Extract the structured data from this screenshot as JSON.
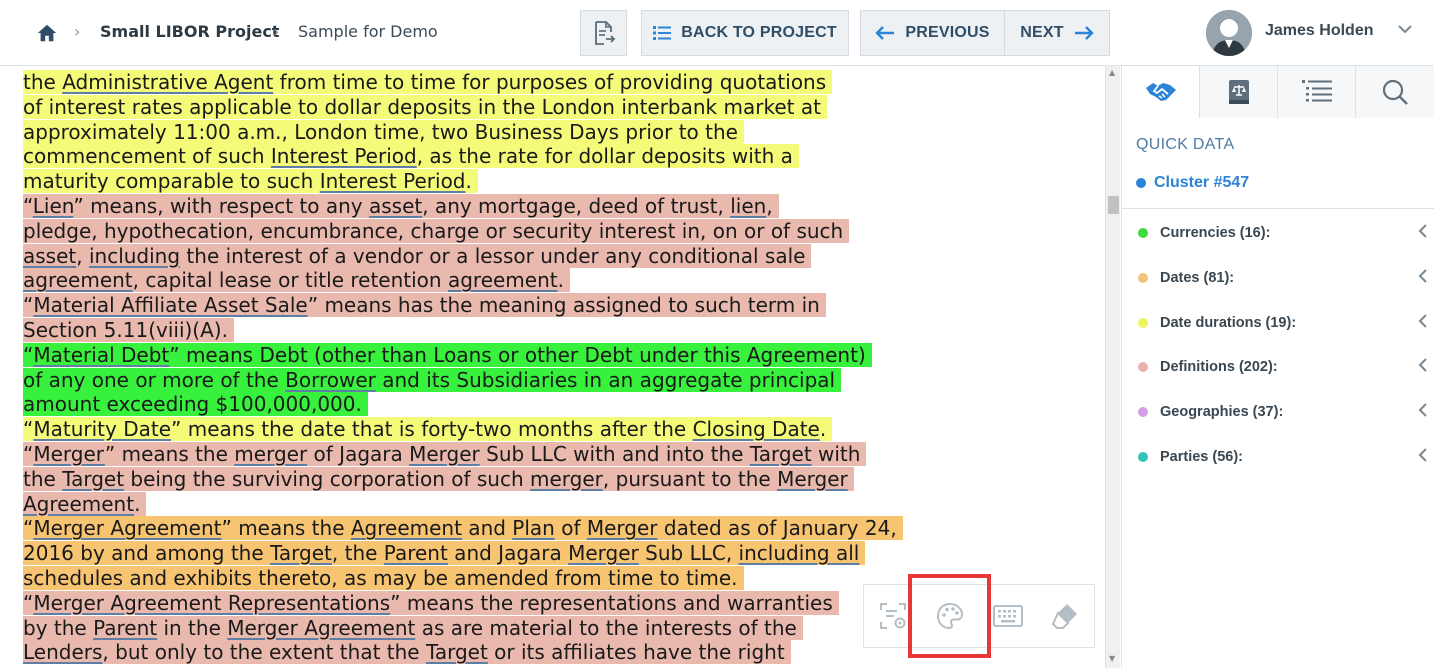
{
  "breadcrumb": {
    "project": "Small LIBOR Project",
    "document": "Sample for Demo"
  },
  "toolbar": {
    "back_label": "BACK TO PROJECT",
    "previous_label": "PREVIOUS",
    "next_label": "NEXT"
  },
  "user": {
    "name": "James Holden"
  },
  "document": {
    "lines": [
      {
        "hl": "y",
        "parts": [
          [
            "the "
          ],
          [
            "Administrative Agent",
            "u"
          ],
          [
            " from time to time for purposes of providing quotations"
          ]
        ]
      },
      {
        "hl": "y",
        "parts": [
          [
            "of interest rates applicable to dollar deposits in the London interbank market at"
          ]
        ]
      },
      {
        "hl": "y",
        "parts": [
          [
            "approximately 11:00 a.m., London time, two Business Days prior to the"
          ]
        ]
      },
      {
        "hl": "y",
        "parts": [
          [
            "commencement of such "
          ],
          [
            "Interest Period",
            "u"
          ],
          [
            ", as the rate for dollar deposits with a"
          ]
        ]
      },
      {
        "hl": "y",
        "parts": [
          [
            "maturity comparable to such "
          ],
          [
            "Interest Period",
            "u"
          ],
          [
            "."
          ]
        ]
      },
      {
        "hl": "p",
        "parts": [
          [
            "“"
          ],
          [
            "Lien",
            "u"
          ],
          [
            "” means, with respect to any "
          ],
          [
            "asset",
            "u"
          ],
          [
            ", any mortgage, deed of trust, "
          ],
          [
            "lien",
            "u"
          ],
          [
            ","
          ]
        ]
      },
      {
        "hl": "p",
        "parts": [
          [
            "pledge, hypothecation, encumbrance, charge or security interest in, on or of such"
          ]
        ]
      },
      {
        "hl": "p",
        "parts": [
          [
            "asset",
            "u"
          ],
          [
            ", "
          ],
          [
            "including",
            "u"
          ],
          [
            " the interest of a vendor or a lessor under any conditional sale"
          ]
        ]
      },
      {
        "hl": "p",
        "parts": [
          [
            "agreement",
            "u"
          ],
          [
            ", capital lease or title retention "
          ],
          [
            "agreement",
            "u"
          ],
          [
            "."
          ]
        ]
      },
      {
        "hl": "p",
        "parts": [
          [
            "“"
          ],
          [
            "Material Affiliate Asset Sale",
            "u"
          ],
          [
            "” means has the meaning assigned to such term in"
          ]
        ]
      },
      {
        "hl": "p",
        "parts": [
          [
            "Section 5.11(viii)(A)."
          ]
        ]
      },
      {
        "hl": "g",
        "parts": [
          [
            "“"
          ],
          [
            "Material Debt",
            "u"
          ],
          [
            "” means Debt (other than Loans or other Debt under this Agreement)"
          ]
        ]
      },
      {
        "hl": "g",
        "parts": [
          [
            "of any one or more of the "
          ],
          [
            "Borrower",
            "u"
          ],
          [
            " and its Subsidiaries in an aggregate principal"
          ]
        ]
      },
      {
        "hl": "g",
        "parts": [
          [
            "amount exceeding $100,000,000."
          ]
        ]
      },
      {
        "hl": "y",
        "parts": [
          [
            "“"
          ],
          [
            "Maturity Date",
            "u"
          ],
          [
            "” means the date that is forty-two months after the "
          ],
          [
            "Closing Date",
            "u"
          ],
          [
            "."
          ]
        ]
      },
      {
        "hl": "p",
        "parts": [
          [
            "“"
          ],
          [
            "Merger",
            "u"
          ],
          [
            "” means the "
          ],
          [
            "merger",
            "u"
          ],
          [
            " of Jagara "
          ],
          [
            "Merger",
            "u"
          ],
          [
            " Sub LLC with and into the "
          ],
          [
            "Target",
            "u"
          ],
          [
            " with"
          ]
        ]
      },
      {
        "hl": "p",
        "parts": [
          [
            "the "
          ],
          [
            "Target",
            "u"
          ],
          [
            " being the surviving corporation of such "
          ],
          [
            "merger",
            "u"
          ],
          [
            ", pursuant to the "
          ],
          [
            "Merger",
            "u"
          ]
        ]
      },
      {
        "hl": "p",
        "parts": [
          [
            "Agreement",
            "u"
          ],
          [
            "."
          ]
        ]
      },
      {
        "hl": "o",
        "parts": [
          [
            "“"
          ],
          [
            "Merger Agreement",
            "u"
          ],
          [
            "” means the "
          ],
          [
            "Agreement",
            "u"
          ],
          [
            " and "
          ],
          [
            "Plan",
            "u"
          ],
          [
            " of "
          ],
          [
            "Merger",
            "u"
          ],
          [
            " dated as of January 24,"
          ]
        ]
      },
      {
        "hl": "o",
        "parts": [
          [
            "2016 by and among the "
          ],
          [
            "Target",
            "u"
          ],
          [
            ", the "
          ],
          [
            "Parent",
            "u"
          ],
          [
            " and Jagara "
          ],
          [
            "Merger",
            "u"
          ],
          [
            " Sub LLC, "
          ],
          [
            "including all",
            "u"
          ]
        ]
      },
      {
        "hl": "o",
        "parts": [
          [
            "schedules and exhibits thereto, as may be amended from time to time."
          ]
        ]
      },
      {
        "hl": "p",
        "parts": [
          [
            "“"
          ],
          [
            "Merger Agreement Representations",
            "u"
          ],
          [
            "” means the representations and warranties"
          ]
        ]
      },
      {
        "hl": "p",
        "parts": [
          [
            "by the "
          ],
          [
            "Parent",
            "u"
          ],
          [
            " in the "
          ],
          [
            "Merger Agreement",
            "u"
          ],
          [
            " as are material to the interests of the"
          ]
        ]
      },
      {
        "hl": "p",
        "parts": [
          [
            "Lenders",
            "u"
          ],
          [
            ", but only to the extent that the "
          ],
          [
            "Target",
            "u"
          ],
          [
            " or its affiliates have the right"
          ]
        ]
      }
    ]
  },
  "quick_data": {
    "title": "QUICK DATA",
    "cluster": "Cluster #547",
    "categories": [
      {
        "label": "Currencies (16):",
        "color": "#3ddc3a"
      },
      {
        "label": "Dates (81):",
        "color": "#f5c27a"
      },
      {
        "label": "Date durations (19):",
        "color": "#eef55a"
      },
      {
        "label": "Definitions (202):",
        "color": "#e8b3a8"
      },
      {
        "label": "Geographies (37):",
        "color": "#d59ee6"
      },
      {
        "label": "Parties (56):",
        "color": "#2ec4b6"
      }
    ]
  },
  "icons": {
    "home": "home-icon",
    "export": "document-export-icon",
    "back": "list-icon",
    "previous": "arrow-left-icon",
    "next": "arrow-right-icon",
    "tabs": [
      "handshake-icon",
      "law-book-icon",
      "outline-list-icon",
      "search-icon"
    ],
    "tools": [
      "scan-view-icon",
      "palette-icon",
      "keyboard-icon",
      "eraser-icon"
    ]
  },
  "colors": {
    "accent": "#2b84d7",
    "highlight_yellow": "#f3fb78",
    "highlight_pink": "#e9b9ae",
    "highlight_green": "#37f13d",
    "highlight_orange": "#f7c472",
    "selection_box": "#e53935"
  }
}
